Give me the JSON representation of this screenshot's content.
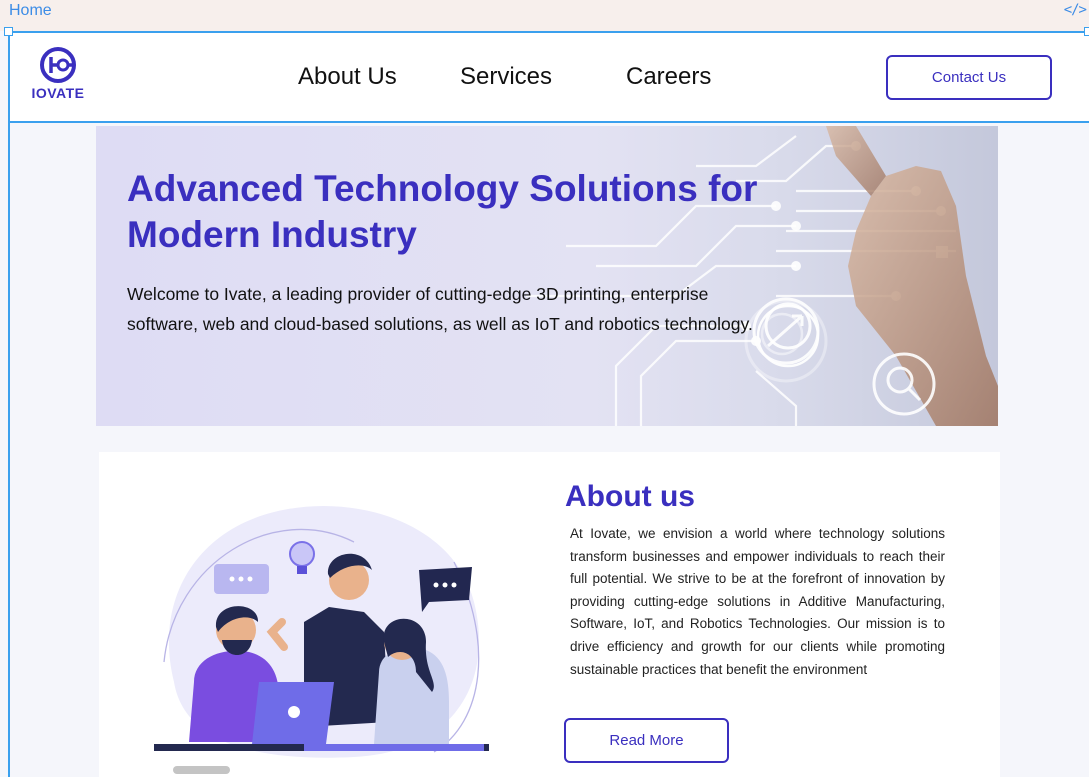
{
  "canvas": {
    "frame_label": "Home",
    "code_glyph": "</>"
  },
  "brand": {
    "name": "IOVATE",
    "color": "#3a2fbf"
  },
  "nav": {
    "links": [
      {
        "label": "About Us"
      },
      {
        "label": "Services"
      },
      {
        "label": "Careers"
      }
    ],
    "contact_label": "Contact Us"
  },
  "hero": {
    "title": "Advanced Technology Solutions for Modern Industry",
    "text": "Welcome to Ivate, a leading provider of cutting-edge 3D printing, enterprise software, web and cloud-based solutions, as well as IoT and robotics technology."
  },
  "about": {
    "title": "About us",
    "text": "At Iovate, we envision a world where technology solutions transform businesses and empower individuals to reach their full potential. We strive to be at the forefront of innovation by providing cutting-edge solutions in Additive Manufacturing, Software, IoT, and Robotics Technologies. Our mission is to drive efficiency and growth for our clients while promoting sustainable practices that benefit the environment",
    "read_more_label": "Read More"
  },
  "colors": {
    "accent": "#3a2fbf",
    "selection": "#3aa0ee",
    "hero_bg": "#dedcf4"
  }
}
